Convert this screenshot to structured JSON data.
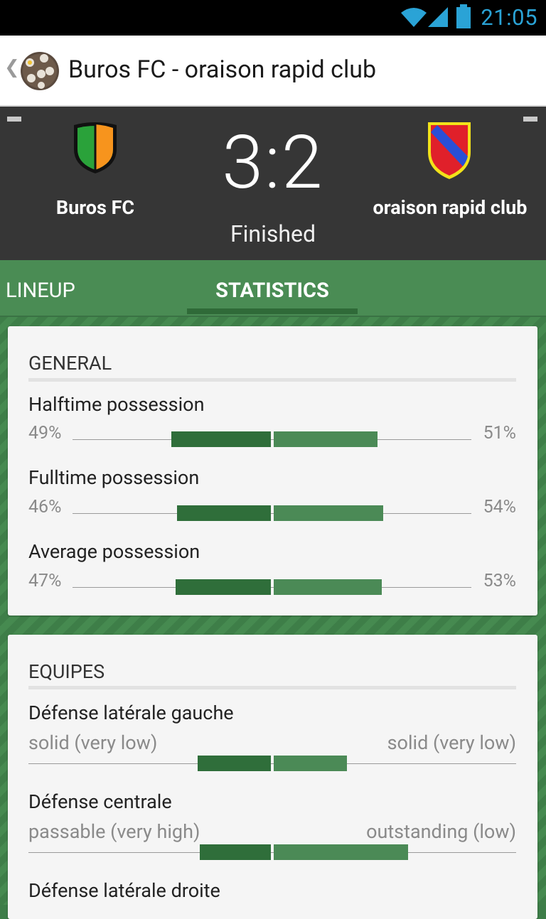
{
  "status_bar": {
    "time": "21:05"
  },
  "action_bar": {
    "back_icon": "chevron-left-icon",
    "app_icon": "soccer-ball-icon",
    "title": "Buros FC - oraison rapid club"
  },
  "match": {
    "home_team": "Buros FC",
    "away_team": "oraison rapid club",
    "score": "3:2",
    "status": "Finished",
    "home_crest_colors": [
      "#2aa23a",
      "#f7941d"
    ],
    "away_crest_colors": [
      "#e0202a",
      "#2a4fd6",
      "#f2e21a"
    ]
  },
  "tabs": [
    {
      "label": "LINEUP",
      "selected": false
    },
    {
      "label": "STATISTICS",
      "selected": true
    }
  ],
  "general": {
    "title": "GENERAL",
    "rows": [
      {
        "label": "Halftime possession",
        "left": "49%",
        "right": "51%",
        "left_value": 49,
        "right_value": 51
      },
      {
        "label": "Fulltime possession",
        "left": "46%",
        "right": "54%",
        "left_value": 46,
        "right_value": 54
      },
      {
        "label": "Average possession",
        "left": "47%",
        "right": "53%",
        "left_value": 47,
        "right_value": 53
      }
    ]
  },
  "equipes": {
    "title": "EQUIPES",
    "rows": [
      {
        "label": "Défense latérale gauche",
        "left": "solid (very low)",
        "right": "solid (very low)",
        "left_value": 0.3,
        "right_value": 0.3
      },
      {
        "label": "Défense centrale",
        "left": "passable (very high)",
        "right": "outstanding (low)",
        "left_value": 0.29,
        "right_value": 0.55
      },
      {
        "label": "Défense latérale droite",
        "left": "",
        "right": ""
      }
    ]
  },
  "colors": {
    "bar_dark": "#2f6e3a",
    "bar_light": "#4b8a56",
    "accent_blue": "#2aa3d6"
  }
}
